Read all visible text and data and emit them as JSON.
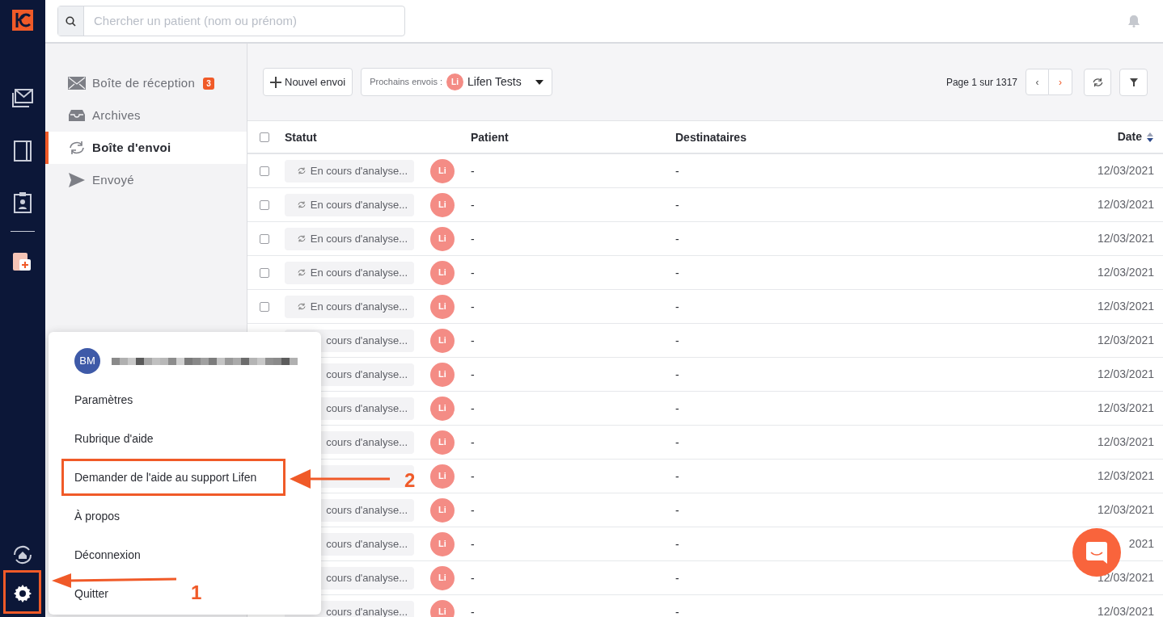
{
  "search": {
    "placeholder": "Chercher un patient (nom ou prénom)"
  },
  "sidebar": {
    "items": [
      {
        "kind": "mail",
        "label": "Boîte de réception",
        "badge": "3",
        "selected": false
      },
      {
        "kind": "archive",
        "label": "Archives",
        "selected": false
      },
      {
        "kind": "sync",
        "label": "Boîte d'envoi",
        "selected": true
      },
      {
        "kind": "send",
        "label": "Envoyé",
        "selected": false
      }
    ]
  },
  "toolbar": {
    "new_button": "Nouvel envoi",
    "next_label": "Prochains envois :",
    "next_avatar": "Li",
    "next_name": "Lifen Tests",
    "pagination": "Page 1 sur 1317",
    "prev": "‹",
    "next": "›"
  },
  "table": {
    "select_all_checked": false,
    "columns": [
      "Statut",
      "Patient",
      "Destinataires",
      "Date"
    ],
    "rows": [
      {
        "checked": false,
        "status": "En cours d'analyse...",
        "avatar": "Li",
        "patient": "-",
        "recipients": "-",
        "date": "12/03/2021"
      },
      {
        "checked": false,
        "status": "En cours d'analyse...",
        "avatar": "Li",
        "patient": "-",
        "recipients": "-",
        "date": "12/03/2021"
      },
      {
        "checked": false,
        "status": "En cours d'analyse...",
        "avatar": "Li",
        "patient": "-",
        "recipients": "-",
        "date": "12/03/2021"
      },
      {
        "checked": false,
        "status": "En cours d'analyse...",
        "avatar": "Li",
        "patient": "-",
        "recipients": "-",
        "date": "12/03/2021"
      },
      {
        "checked": false,
        "status": "En cours d'analyse...",
        "avatar": "Li",
        "patient": "-",
        "recipients": "-",
        "date": "12/03/2021"
      },
      {
        "status": "cours d'analyse...",
        "avatar": "Li",
        "patient": "-",
        "recipients": "-",
        "date": "12/03/2021"
      },
      {
        "status": "cours d'analyse...",
        "avatar": "Li",
        "patient": "-",
        "recipients": "-",
        "date": "12/03/2021"
      },
      {
        "status": "cours d'analyse...",
        "avatar": "Li",
        "patient": "-",
        "recipients": "-",
        "date": "12/03/2021"
      },
      {
        "status": "cours d'analyse...",
        "avatar": "Li",
        "patient": "-",
        "recipients": "-",
        "date": "12/03/2021"
      },
      {
        "avatar": "Li",
        "patient": "-",
        "recipients": "-",
        "date": "12/03/2021"
      },
      {
        "status": "cours d'analyse...",
        "avatar": "Li",
        "patient": "-",
        "recipients": "-",
        "date": "12/03/2021"
      },
      {
        "status": "cours d'analyse...",
        "avatar": "Li",
        "patient": "-",
        "recipients": "-",
        "date": "2021"
      },
      {
        "status": "cours d'analyse...",
        "avatar": "Li",
        "patient": "-",
        "recipients": "-",
        "date": "12/03/2021"
      },
      {
        "status": "cours d'analyse...",
        "avatar": "Li",
        "patient": "-",
        "recipients": "-",
        "date": "12/03/2021"
      }
    ]
  },
  "menu": {
    "user_initials": "BM",
    "items": [
      {
        "label": "Paramètres",
        "boxed": false
      },
      {
        "label": "Rubrique d'aide",
        "boxed": false
      },
      {
        "label": "Demander de l'aide au support Lifen",
        "boxed": true
      },
      {
        "label": "À propos",
        "boxed": false
      },
      {
        "label": "Déconnexion",
        "boxed": false
      },
      {
        "label": "Quitter",
        "boxed": false
      }
    ]
  },
  "annotations": [
    {
      "kind": "settings",
      "label": "1"
    },
    {
      "kind": "menu",
      "label": "2"
    }
  ]
}
